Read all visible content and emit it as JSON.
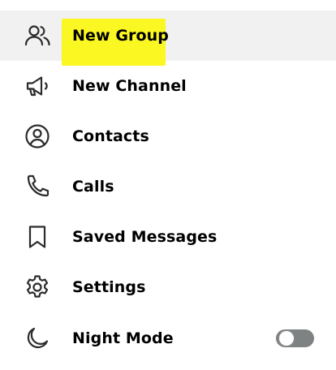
{
  "menu": {
    "items": [
      {
        "label": "New Group",
        "icon": "group-icon",
        "highlighted": true
      },
      {
        "label": "New Channel",
        "icon": "megaphone-icon"
      },
      {
        "label": "Contacts",
        "icon": "user-circle-icon"
      },
      {
        "label": "Calls",
        "icon": "phone-icon"
      },
      {
        "label": "Saved Messages",
        "icon": "bookmark-icon"
      },
      {
        "label": "Settings",
        "icon": "gear-icon"
      },
      {
        "label": "Night Mode",
        "icon": "moon-icon"
      }
    ],
    "night_mode_enabled": false
  },
  "colors": {
    "highlight": "#fbf722",
    "hover_bg": "#f1f1f1",
    "text": "#000000",
    "toggle_off": "#7f8282"
  }
}
